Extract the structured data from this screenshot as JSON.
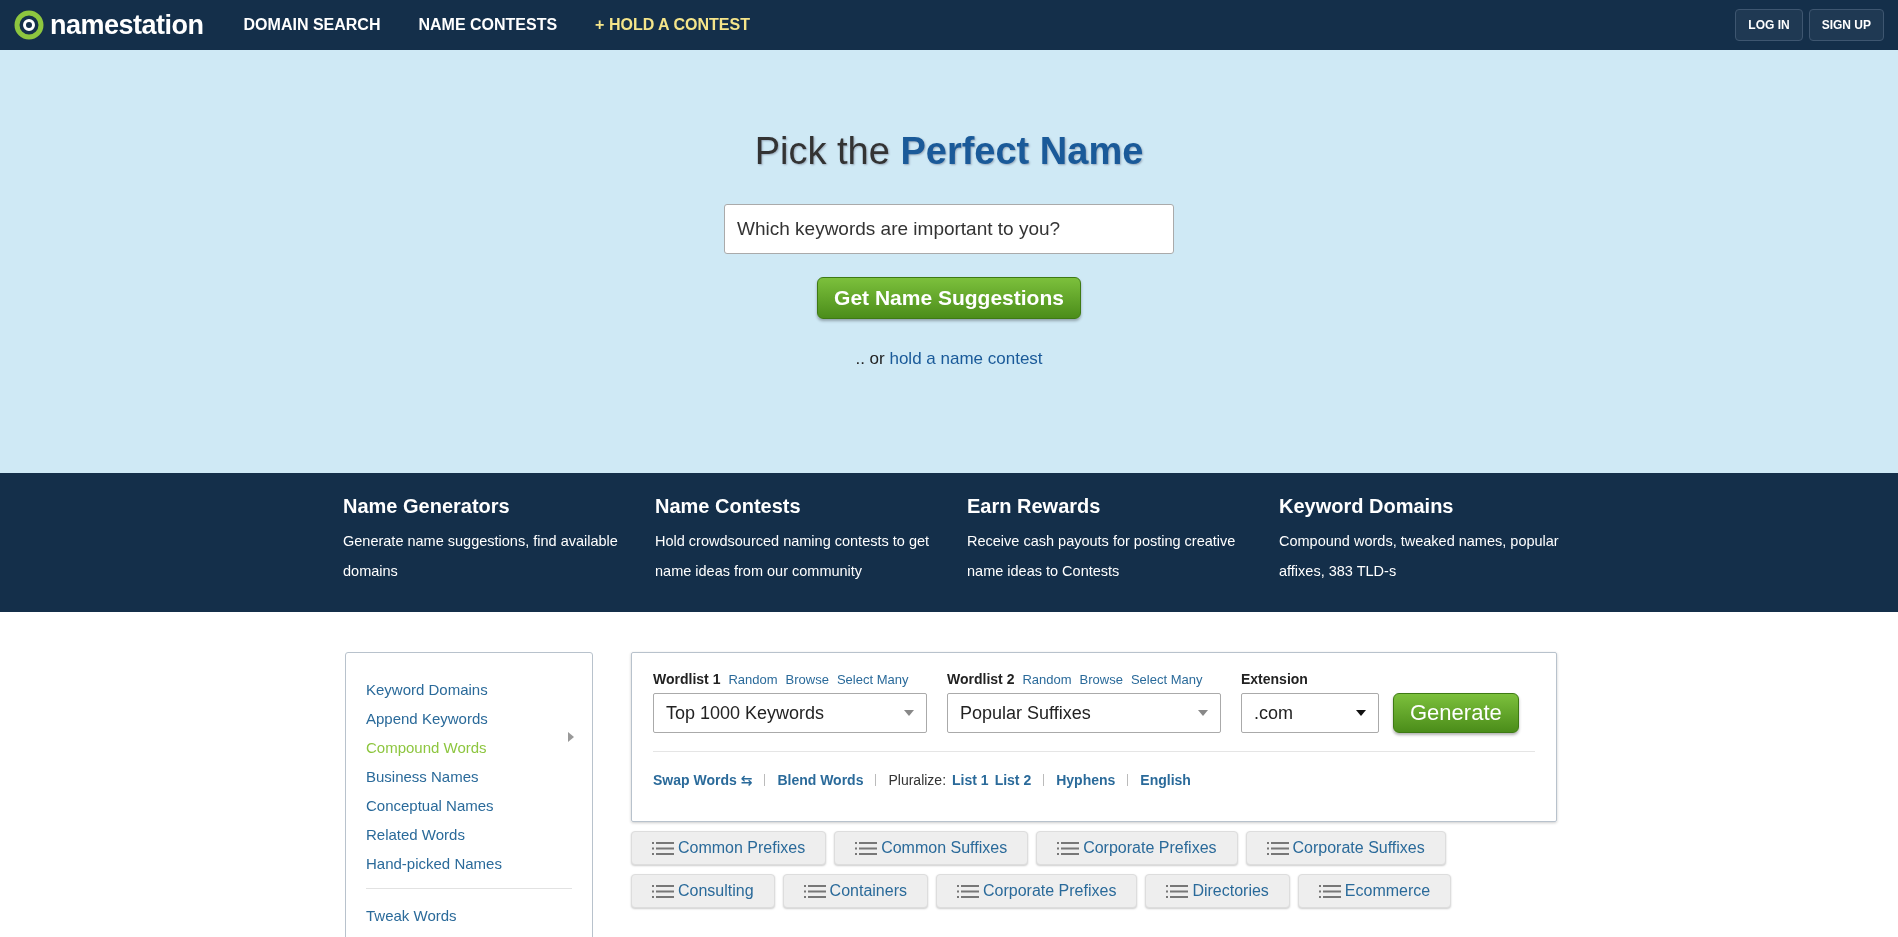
{
  "nav": {
    "logo": "namestation",
    "links": [
      {
        "label": "DOMAIN SEARCH",
        "highlight": false
      },
      {
        "label": "NAME CONTESTS",
        "highlight": false
      },
      {
        "label": "+ HOLD A CONTEST",
        "highlight": true
      }
    ],
    "buttons": [
      "LOG IN",
      "SIGN UP"
    ]
  },
  "hero": {
    "title_plain": "Pick the",
    "title_strong": "Perfect Name",
    "search": {
      "placeholder": "Which keywords are important to you?"
    },
    "button": "Get Name Suggestions",
    "alt_prefix": ".. or",
    "alt_link": "hold a name contest"
  },
  "features": [
    {
      "title": "Name Generators",
      "text": "Generate name suggestions, find available domains"
    },
    {
      "title": "Name Contests",
      "text": "Hold crowdsourced naming contests to get name ideas from our community"
    },
    {
      "title": "Earn Rewards",
      "text": "Receive cash payouts for posting creative name ideas to Contests"
    },
    {
      "title": "Keyword Domains",
      "text": "Compound words, tweaked names, popular affixes, 383 TLD-s"
    }
  ],
  "sidebar": {
    "groups": [
      [
        {
          "label": "Keyword Domains",
          "selected": false
        },
        {
          "label": "Append Keywords",
          "selected": false
        },
        {
          "label": "Compound Words",
          "selected": true
        },
        {
          "label": "Business Names",
          "selected": false
        },
        {
          "label": "Conceptual Names",
          "selected": false
        },
        {
          "label": "Related Words",
          "selected": false
        },
        {
          "label": "Hand-picked Names",
          "selected": false
        }
      ],
      [
        {
          "label": "Tweak Words",
          "selected": false
        }
      ]
    ]
  },
  "generator": {
    "wordlists": [
      {
        "label": "Wordlist 1",
        "links": [
          "Random",
          "Browse",
          "Select Many"
        ],
        "value": "Top 1000 Keywords"
      },
      {
        "label": "Wordlist 2",
        "links": [
          "Random",
          "Browse",
          "Select Many"
        ],
        "value": "Popular Suffixes"
      }
    ],
    "extension": {
      "label": "Extension",
      "value": ".com"
    },
    "button": "Generate",
    "options": [
      {
        "kind": "link",
        "text": "Swap Words ⇆"
      },
      {
        "kind": "sep"
      },
      {
        "kind": "link",
        "text": "Blend Words"
      },
      {
        "kind": "sep"
      },
      {
        "kind": "label",
        "text": "Pluralize:"
      },
      {
        "kind": "link",
        "text": "List 1"
      },
      {
        "kind": "link",
        "text": "List 2"
      },
      {
        "kind": "sep"
      },
      {
        "kind": "link",
        "text": "Hyphens"
      },
      {
        "kind": "sep"
      },
      {
        "kind": "link",
        "text": "English"
      }
    ]
  },
  "tag_rows": [
    [
      "Common Prefixes",
      "Common Suffixes",
      "Corporate Prefixes",
      "Corporate Suffixes"
    ],
    [
      "Consulting",
      "Containers",
      "Corporate Prefixes",
      "Directories",
      "Ecommerce"
    ]
  ]
}
